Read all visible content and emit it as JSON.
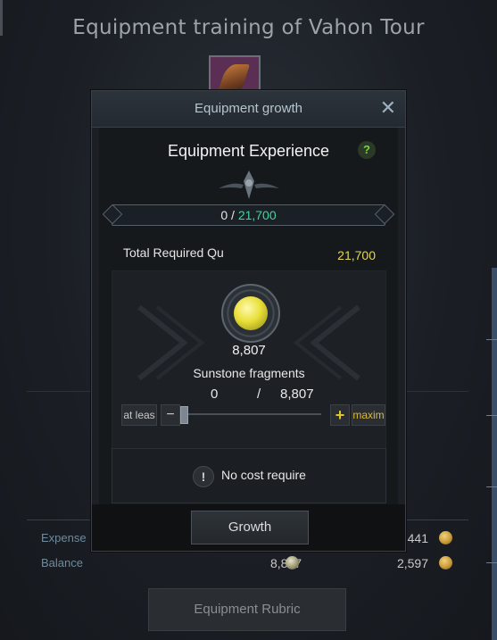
{
  "background": {
    "title": "Equipment training of Vahon Tour",
    "rows": [
      {
        "label": "Expense",
        "value1": "",
        "value2": "441"
      },
      {
        "label": "Balance",
        "value1": "8,807",
        "value2": "2,597"
      }
    ],
    "bottom_button": "Equipment Rubric"
  },
  "modal": {
    "title": "Equipment growth",
    "close_icon": "close-icon",
    "section_title": "Equipment Experience",
    "help_label": "?",
    "exp": {
      "current": "0",
      "separator": "/",
      "max": "21,700"
    },
    "required_label": "Total Required Qu",
    "required_value": "21,700",
    "material": {
      "count": "8,807",
      "name": "Sunstone fragments",
      "selected": "0",
      "separator": "/",
      "available": "8,807"
    },
    "stepper": {
      "min_label": "at leas",
      "minus": "−",
      "plus": "+",
      "max_label": "maxim",
      "value_fraction": 0
    },
    "cost": {
      "icon": "!",
      "text": "No cost require"
    },
    "growth_button": "Growth"
  },
  "colors": {
    "accent_green": "#3fd69c",
    "accent_yellow": "#e3d65a",
    "plus_yellow": "#e3c430"
  }
}
